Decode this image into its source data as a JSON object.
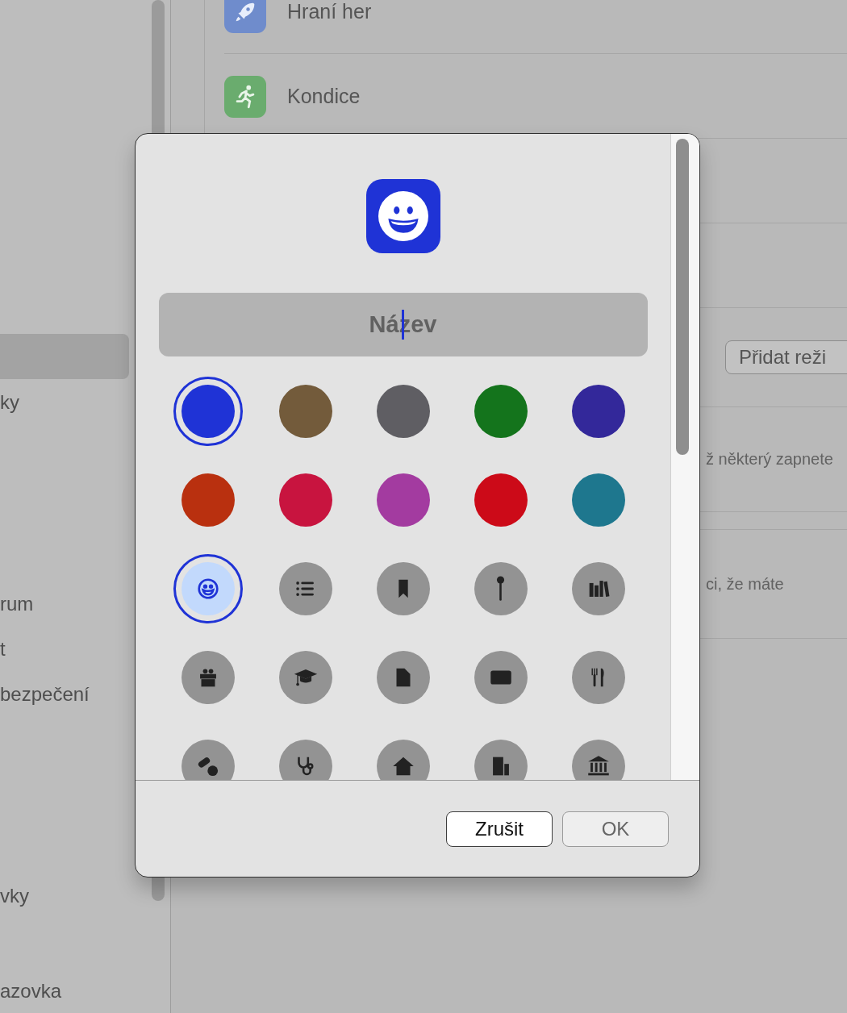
{
  "sidebar": {
    "items": [
      {
        "selected": true
      },
      {
        "label": "ky",
        "selected": false
      },
      {
        "label": "rum",
        "selected": false
      },
      {
        "label": "t",
        "selected": false
      },
      {
        "label": "bezpečení",
        "selected": false
      },
      {
        "label": "vky",
        "selected": false
      },
      {
        "label": "azovka",
        "selected": false
      }
    ]
  },
  "main": {
    "focus_modes": [
      {
        "label": "Hraní her",
        "color": "#6f8ccc"
      },
      {
        "label": "Kondice",
        "color": "#6aac6e"
      }
    ],
    "add_button": "Přidat reži",
    "note_1": "ž některý zapnete",
    "note_2": "ci, že máte"
  },
  "dialog": {
    "name_field": {
      "placeholder": "Název"
    },
    "colors": [
      {
        "color": "#1f33d6",
        "selected": true
      },
      {
        "color": "#735b3b",
        "selected": false
      },
      {
        "color": "#5f5e63",
        "selected": false
      },
      {
        "color": "#14741c",
        "selected": false
      },
      {
        "color": "#33289a",
        "selected": false
      },
      {
        "color": "#b9300f",
        "selected": false
      },
      {
        "color": "#c8143f",
        "selected": false
      },
      {
        "color": "#a33ba0",
        "selected": false
      },
      {
        "color": "#cc0a18",
        "selected": false
      },
      {
        "color": "#1e778e",
        "selected": false
      }
    ],
    "symbols": [
      {
        "selected": true
      },
      {
        "selected": false
      },
      {
        "selected": false
      },
      {
        "selected": false
      },
      {
        "selected": false
      },
      {
        "selected": false
      },
      {
        "selected": false
      },
      {
        "selected": false
      },
      {
        "selected": false
      },
      {
        "selected": false
      },
      {
        "selected": false
      },
      {
        "selected": false
      },
      {
        "selected": false
      },
      {
        "selected": false
      },
      {
        "selected": false
      }
    ],
    "buttons": [
      {
        "label": "Zrušit",
        "disabled": false
      },
      {
        "label": "OK",
        "disabled": true
      }
    ]
  }
}
